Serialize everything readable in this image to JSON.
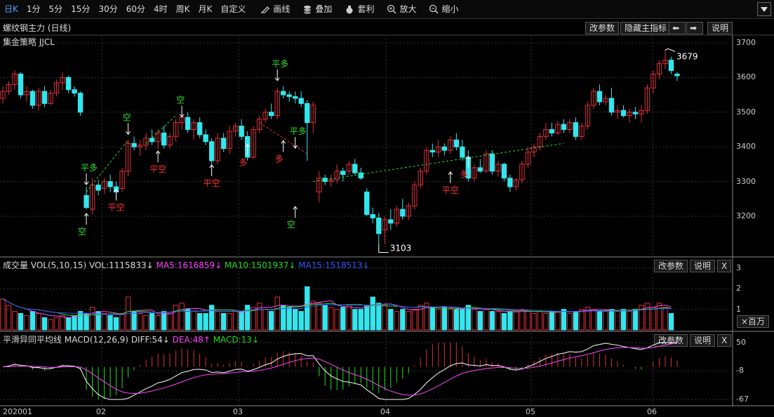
{
  "toolbar": {
    "periods": [
      "日K",
      "1分",
      "5分",
      "15分",
      "30分",
      "60分",
      "4时",
      "周K",
      "月K",
      "自定义"
    ],
    "active": "日K",
    "tools": [
      {
        "label": "画线",
        "icon": "pencil-icon"
      },
      {
        "label": "叠加",
        "icon": "stack-icon"
      },
      {
        "label": "套利",
        "icon": "money-bag-icon"
      },
      {
        "label": "放大",
        "icon": "zoom-in-icon"
      },
      {
        "label": "缩小",
        "icon": "zoom-out-icon"
      }
    ]
  },
  "main_panel": {
    "title": "螺纹钢主力 (日线)",
    "strategy": "集金策略 JJCL",
    "buttons": {
      "params": "改参数",
      "hide": "隐藏主指标",
      "explain": "说明"
    }
  },
  "volume_panel": {
    "label": "成交量",
    "vol": "VOL(5,10,15)",
    "vol_value": "VOL:1115833↓",
    "ma5": "MA5:1616859↓",
    "ma10": "MA10:1501937↓",
    "ma15": "MA15:1518513↓",
    "buttons": {
      "params": "改参数",
      "explain": "说明",
      "close": "X"
    },
    "unit_label": "×百万"
  },
  "macd_panel": {
    "label": "平滑异同平均线",
    "macd": "MACD(12,26,9)",
    "diff": "DIFF:54↓",
    "dea": "DEA:48↑",
    "macd_value": "MACD:13↓",
    "buttons": {
      "params": "改参数",
      "explain": "说明",
      "close": "X"
    }
  },
  "colors": {
    "up": "#e0303a",
    "down": "#33e6ee",
    "ma5": "#ff44ff",
    "ma10": "#22dd22",
    "ma15": "#3355ff",
    "signal_green": "#33dd33",
    "signal_red": "#ff3333"
  },
  "chart_data": {
    "type": "candlestick",
    "x_ticks": [
      "202001",
      "02",
      "03",
      "04",
      "05",
      "06"
    ],
    "price_axis": [
      3700,
      3600,
      3500,
      3400,
      3300,
      3200
    ],
    "volume_axis": [
      3,
      2,
      1
    ],
    "macd_axis": [
      50,
      -8,
      -67
    ],
    "annotations": {
      "high": "3679",
      "low": "3103"
    },
    "signals": [
      {
        "label": "平多",
        "color": "green"
      },
      {
        "label": "空",
        "color": "green"
      },
      {
        "label": "平空",
        "color": "red"
      },
      {
        "label": "空",
        "color": "green"
      },
      {
        "label": "平空",
        "color": "red"
      },
      {
        "label": "空",
        "color": "green"
      },
      {
        "label": "平空",
        "color": "red"
      },
      {
        "label": "多",
        "color": "red"
      },
      {
        "label": "平多",
        "color": "green"
      },
      {
        "label": "多",
        "color": "red"
      },
      {
        "label": "平多",
        "color": "green"
      },
      {
        "label": "空",
        "color": "green"
      },
      {
        "label": "平空",
        "color": "red"
      },
      {
        "label": "多",
        "color": "red"
      }
    ],
    "candles": [
      [
        3540,
        3575,
        3525,
        3560
      ],
      [
        3560,
        3590,
        3550,
        3580
      ],
      [
        3580,
        3620,
        3565,
        3610
      ],
      [
        3610,
        3615,
        3540,
        3550
      ],
      [
        3550,
        3575,
        3530,
        3560
      ],
      [
        3560,
        3565,
        3510,
        3520
      ],
      [
        3520,
        3570,
        3505,
        3560
      ],
      [
        3560,
        3575,
        3515,
        3525
      ],
      [
        3525,
        3565,
        3520,
        3555
      ],
      [
        3555,
        3595,
        3545,
        3585
      ],
      [
        3585,
        3615,
        3565,
        3600
      ],
      [
        3600,
        3605,
        3555,
        3565
      ],
      [
        3565,
        3575,
        3545,
        3555
      ],
      [
        3555,
        3560,
        3490,
        3500
      ],
      [
        3260,
        3285,
        3220,
        3225
      ],
      [
        3220,
        3310,
        3205,
        3290
      ],
      [
        3290,
        3305,
        3260,
        3275
      ],
      [
        3280,
        3310,
        3265,
        3300
      ],
      [
        3300,
        3320,
        3270,
        3285
      ],
      [
        3285,
        3300,
        3250,
        3270
      ],
      [
        3280,
        3340,
        3270,
        3330
      ],
      [
        3330,
        3420,
        3315,
        3410
      ],
      [
        3410,
        3430,
        3390,
        3400
      ],
      [
        3400,
        3420,
        3375,
        3405
      ],
      [
        3405,
        3440,
        3390,
        3425
      ],
      [
        3425,
        3450,
        3405,
        3415
      ],
      [
        3415,
        3450,
        3395,
        3440
      ],
      [
        3440,
        3460,
        3395,
        3405
      ],
      [
        3405,
        3440,
        3395,
        3430
      ],
      [
        3430,
        3480,
        3415,
        3470
      ],
      [
        3470,
        3495,
        3450,
        3485
      ],
      [
        3485,
        3500,
        3440,
        3450
      ],
      [
        3450,
        3480,
        3420,
        3470
      ],
      [
        3470,
        3485,
        3425,
        3435
      ],
      [
        3435,
        3450,
        3405,
        3415
      ],
      [
        3415,
        3425,
        3345,
        3360
      ],
      [
        3360,
        3440,
        3350,
        3425
      ],
      [
        3425,
        3440,
        3385,
        3395
      ],
      [
        3395,
        3460,
        3380,
        3445
      ],
      [
        3445,
        3470,
        3430,
        3460
      ],
      [
        3460,
        3480,
        3420,
        3430
      ],
      [
        3430,
        3445,
        3360,
        3370
      ],
      [
        3370,
        3460,
        3365,
        3450
      ],
      [
        3450,
        3490,
        3440,
        3480
      ],
      [
        3480,
        3510,
        3470,
        3500
      ],
      [
        3500,
        3525,
        3480,
        3490
      ],
      [
        3490,
        3570,
        3480,
        3560
      ],
      [
        3560,
        3575,
        3540,
        3550
      ],
      [
        3550,
        3560,
        3530,
        3545
      ],
      [
        3545,
        3560,
        3525,
        3540
      ],
      [
        3540,
        3560,
        3515,
        3525
      ],
      [
        3525,
        3535,
        3360,
        3470
      ],
      [
        3470,
        3530,
        3440,
        3520
      ],
      [
        3270,
        3330,
        3240,
        3310
      ],
      [
        3310,
        3320,
        3290,
        3300
      ],
      [
        3300,
        3320,
        3285,
        3305
      ],
      [
        3305,
        3350,
        3295,
        3330
      ],
      [
        3330,
        3340,
        3300,
        3320
      ],
      [
        3330,
        3360,
        3320,
        3350
      ],
      [
        3350,
        3365,
        3320,
        3325
      ],
      [
        3325,
        3340,
        3305,
        3310
      ],
      [
        3270,
        3280,
        3200,
        3205
      ],
      [
        3205,
        3225,
        3180,
        3195
      ],
      [
        3195,
        3210,
        3120,
        3150
      ],
      [
        3160,
        3200,
        3120,
        3190
      ],
      [
        3190,
        3220,
        3160,
        3180
      ],
      [
        3180,
        3230,
        3170,
        3220
      ],
      [
        3220,
        3250,
        3190,
        3200
      ],
      [
        3200,
        3240,
        3190,
        3230
      ],
      [
        3230,
        3300,
        3220,
        3290
      ],
      [
        3290,
        3340,
        3280,
        3330
      ],
      [
        3330,
        3400,
        3320,
        3390
      ],
      [
        3390,
        3410,
        3370,
        3385
      ],
      [
        3385,
        3420,
        3370,
        3400
      ],
      [
        3400,
        3410,
        3375,
        3390
      ],
      [
        3390,
        3430,
        3380,
        3420
      ],
      [
        3420,
        3440,
        3390,
        3400
      ],
      [
        3400,
        3420,
        3360,
        3370
      ],
      [
        3370,
        3390,
        3300,
        3310
      ],
      [
        3310,
        3350,
        3300,
        3340
      ],
      [
        3340,
        3365,
        3325,
        3330
      ],
      [
        3330,
        3390,
        3325,
        3380
      ],
      [
        3380,
        3390,
        3320,
        3330
      ],
      [
        3330,
        3360,
        3315,
        3350
      ],
      [
        3350,
        3355,
        3300,
        3310
      ],
      [
        3310,
        3320,
        3270,
        3285
      ],
      [
        3285,
        3310,
        3275,
        3305
      ],
      [
        3305,
        3360,
        3295,
        3350
      ],
      [
        3350,
        3400,
        3340,
        3385
      ],
      [
        3385,
        3410,
        3370,
        3400
      ],
      [
        3400,
        3440,
        3390,
        3430
      ],
      [
        3430,
        3470,
        3420,
        3450
      ],
      [
        3450,
        3470,
        3430,
        3440
      ],
      [
        3440,
        3475,
        3435,
        3465
      ],
      [
        3465,
        3480,
        3440,
        3450
      ],
      [
        3450,
        3480,
        3440,
        3470
      ],
      [
        3470,
        3485,
        3420,
        3430
      ],
      [
        3430,
        3470,
        3420,
        3460
      ],
      [
        3460,
        3530,
        3450,
        3520
      ],
      [
        3520,
        3570,
        3510,
        3560
      ],
      [
        3560,
        3580,
        3520,
        3530
      ],
      [
        3530,
        3550,
        3520,
        3540
      ],
      [
        3540,
        3570,
        3490,
        3500
      ],
      [
        3500,
        3520,
        3480,
        3505
      ],
      [
        3505,
        3520,
        3485,
        3490
      ],
      [
        3490,
        3510,
        3470,
        3500
      ],
      [
        3500,
        3515,
        3480,
        3495
      ],
      [
        3495,
        3520,
        3470,
        3505
      ],
      [
        3505,
        3580,
        3495,
        3570
      ],
      [
        3570,
        3620,
        3555,
        3610
      ],
      [
        3610,
        3650,
        3595,
        3640
      ],
      [
        3640,
        3679,
        3625,
        3650
      ],
      [
        3650,
        3660,
        3610,
        3620
      ],
      [
        3610,
        3615,
        3590,
        3605
      ]
    ],
    "volume": [
      1.5,
      1.2,
      0.9,
      0.8,
      0.7,
      0.9,
      0.8,
      0.6,
      0.5,
      0.6,
      0.7,
      0.6,
      0.7,
      0.9,
      0.8,
      1.1,
      0.9,
      0.8,
      0.7,
      0.6,
      0.8,
      1.6,
      0.9,
      0.8,
      0.7,
      0.8,
      0.7,
      0.9,
      0.8,
      1.2,
      1.3,
      1.0,
      0.9,
      0.8,
      0.8,
      1.2,
      0.9,
      0.8,
      0.8,
      0.9,
      0.9,
      1.2,
      1.1,
      1.3,
      1.0,
      0.9,
      1.6,
      1.2,
      1.1,
      1.0,
      0.9,
      2.1,
      1.4,
      1.3,
      1.2,
      1.1,
      1.0,
      1.1,
      1.2,
      1.0,
      1.0,
      1.2,
      1.6,
      1.3,
      1.2,
      1.0,
      0.9,
      1.0,
      0.9,
      1.0,
      1.2,
      1.3,
      1.1,
      1.0,
      1.1,
      1.0,
      1.0,
      1.0,
      1.2,
      1.0,
      0.9,
      1.0,
      0.9,
      0.9,
      0.8,
      0.9,
      0.9,
      1.0,
      0.9,
      0.8,
      0.9,
      0.8,
      0.9,
      0.9,
      1.0,
      0.8,
      0.9,
      1.0,
      1.1,
      1.0,
      0.9,
      0.9,
      1.0,
      0.9,
      1.0,
      0.9,
      1.0,
      1.2,
      1.3,
      1.1,
      1.3,
      1.1,
      0.8
    ]
  }
}
